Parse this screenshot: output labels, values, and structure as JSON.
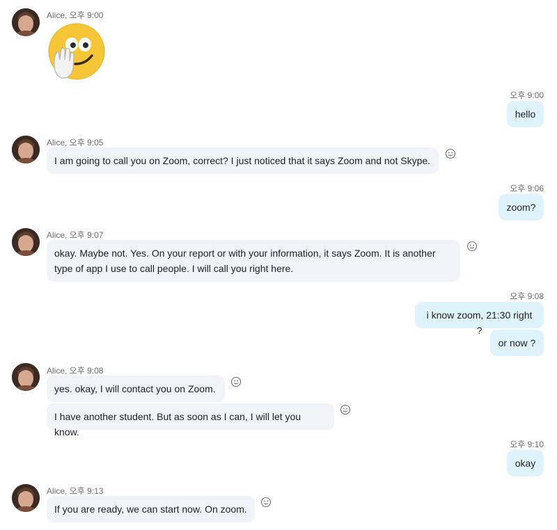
{
  "messages": [
    {
      "sender": "Alice",
      "time": "오후 9:00",
      "sticker": "waving-smiley-sticker"
    },
    {
      "sender": "me",
      "time": "오후 9:00",
      "text": "hello"
    },
    {
      "sender": "Alice",
      "time": "오후 9:05",
      "text": "I am going to call you on Zoom, correct?  I just noticed that it says Zoom and not Skype."
    },
    {
      "sender": "me",
      "time": "오후 9:06",
      "text": "zoom?"
    },
    {
      "sender": "Alice",
      "time": "오후 9:07",
      "text": "okay.  Maybe not.  Yes.  On your report or with your information, it says Zoom.  It is another type of app I use to call people.  I will call you right here."
    },
    {
      "sender": "me",
      "time": "오후 9:08",
      "texts": [
        "i know zoom, 21:30 right ?",
        "or now ?"
      ]
    },
    {
      "sender": "Alice",
      "time": "오후 9:08",
      "texts": [
        "yes.  okay, I will contact you on Zoom.",
        "I have another student.  But as soon as I can, I will let you know."
      ]
    },
    {
      "sender": "me",
      "time": "오후 9:10",
      "text": "okay"
    },
    {
      "sender": "Alice",
      "time": "오후 9:13",
      "text": "If you are ready, we can start now.  On zoom."
    }
  ],
  "labels": {
    "m1": "Alice, 오후 9:00",
    "m3": "Alice, 오후 9:05",
    "m5": "Alice, 오후 9:07",
    "m7": "Alice, 오후 9:08",
    "m9": "Alice, 오후 9:13"
  },
  "icons": {
    "reaction": "smiley-react-icon"
  }
}
